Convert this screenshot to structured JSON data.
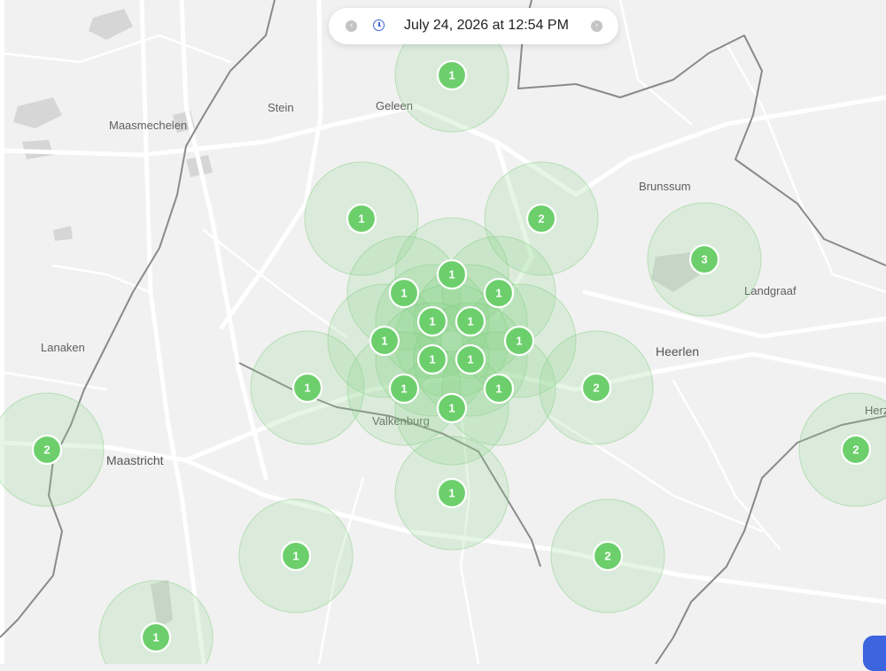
{
  "timebar": {
    "datetime": "July 24, 2026 at 12:54 PM",
    "prev_icon": "chevron-left-icon",
    "next_icon": "chevron-right-icon",
    "clock_icon": "clock-icon"
  },
  "places": [
    "Maasmechelen",
    "Stein",
    "Geleen",
    "Brunssum",
    "Landgraaf",
    "Lanaken",
    "Heerlen",
    "Valkenburg",
    "Maastricht",
    "Herz"
  ],
  "clusters": [
    {
      "count": "1"
    },
    {
      "count": "1"
    },
    {
      "count": "2"
    },
    {
      "count": "3"
    },
    {
      "count": "1"
    },
    {
      "count": "1"
    },
    {
      "count": "1"
    },
    {
      "count": "1"
    },
    {
      "count": "1"
    },
    {
      "count": "1"
    },
    {
      "count": "1"
    },
    {
      "count": "1"
    },
    {
      "count": "1"
    },
    {
      "count": "1"
    },
    {
      "count": "1"
    },
    {
      "count": "1"
    },
    {
      "count": "1"
    },
    {
      "count": "2"
    },
    {
      "count": "2"
    },
    {
      "count": "2"
    },
    {
      "count": "1"
    },
    {
      "count": "1"
    },
    {
      "count": "2"
    },
    {
      "count": "1"
    }
  ],
  "colors": {
    "marker": "#6ccf6c",
    "accent": "#3b63d8",
    "map_bg": "#f1f1f1"
  }
}
